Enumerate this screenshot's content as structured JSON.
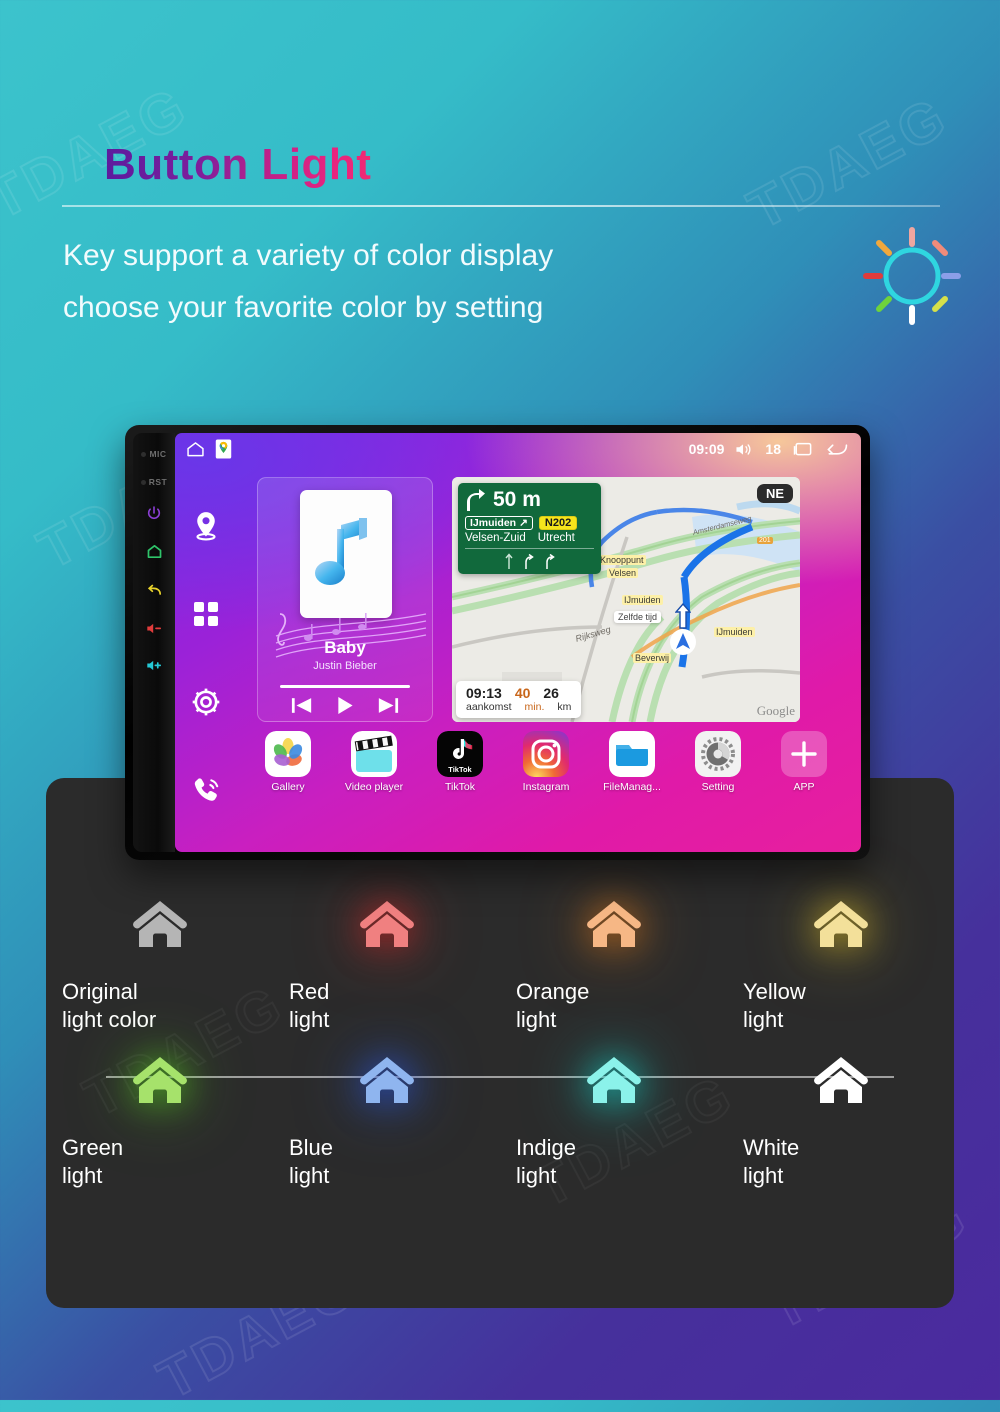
{
  "header": {
    "title": "Button Light",
    "subtitle_line1": "Key support a variety of color display",
    "subtitle_line2": "choose your favorite color by setting",
    "icon": "sun-brightness-icon"
  },
  "watermark": {
    "text": "TDAEG"
  },
  "device": {
    "bezel": {
      "mic_label": "MIC",
      "reset_label": "RST",
      "buttons": [
        {
          "name": "power-button",
          "color": "#8b3fd4"
        },
        {
          "name": "home-button",
          "color": "#2fc46a"
        },
        {
          "name": "back-button",
          "color": "#e8d game"
        },
        {
          "name": "volume-down-button",
          "color": "#e03c3c"
        },
        {
          "name": "volume-up-button",
          "color": "#25c9d6"
        }
      ]
    },
    "statusbar": {
      "home_icon": "home-icon",
      "maps_icon": "google-maps-pin-icon",
      "time": "09:09",
      "volume_icon": "volume-icon",
      "volume_level": "18",
      "recents_icon": "recent-apps-icon",
      "back_icon": "back-arrow-icon"
    },
    "rail": [
      {
        "name": "navigation-icon",
        "label": "navigation"
      },
      {
        "name": "apps-grid-icon",
        "label": "apps"
      },
      {
        "name": "settings-gear-icon",
        "label": "settings"
      },
      {
        "name": "phone-icon",
        "label": "phone"
      }
    ],
    "music": {
      "title": "Baby",
      "artist": "Justin Bieber",
      "album_art": "music-note-icon",
      "prev_icon": "previous-track-icon",
      "play_icon": "play-icon",
      "next_icon": "next-track-icon"
    },
    "map": {
      "distance": "50 m",
      "turn_icon": "turn-right-icon",
      "destination": "IJmuiden",
      "road_number": "N202",
      "exit_left": "Velsen-Zuid",
      "exit_right": "Utrecht",
      "compass": "NE",
      "eta_time": "09:13",
      "eta_time_label": "aankomst",
      "eta_minutes": "40",
      "eta_minutes_label": "min.",
      "eta_distance": "26",
      "eta_distance_label": "km",
      "attribution": "Google",
      "labels": [
        "Knooppunt",
        "Velsen",
        "IJmuiden",
        "IJmuiden",
        "Beverwij",
        "Zelfde tijd",
        "Rijksweg",
        "Amsterdamseweg",
        "201"
      ]
    },
    "dock": [
      {
        "name": "gallery",
        "label": "Gallery"
      },
      {
        "name": "video-player",
        "label": "Video player"
      },
      {
        "name": "tiktok",
        "label": "TikTok"
      },
      {
        "name": "instagram",
        "label": "Instagram"
      },
      {
        "name": "file-manager",
        "label": "FileManag..."
      },
      {
        "name": "setting",
        "label": "Setting"
      },
      {
        "name": "app-add",
        "label": "APP"
      }
    ]
  },
  "colors": [
    {
      "name": "original",
      "label_line1": "Original",
      "label_line2": "light color",
      "hex": "#b5b5b5",
      "glow": "rgba(0,0,0,0)"
    },
    {
      "name": "red",
      "label_line1": "Red",
      "label_line2": "light",
      "hex": "#f08080",
      "glow": "rgba(235,40,40,0.55)"
    },
    {
      "name": "orange",
      "label_line1": "Orange",
      "label_line2": "light",
      "hex": "#f6b785",
      "glow": "rgba(240,130,25,0.55)"
    },
    {
      "name": "yellow",
      "label_line1": "Yellow",
      "label_line2": "light",
      "hex": "#f3e09a",
      "glow": "rgba(240,205,40,0.55)"
    },
    {
      "name": "green",
      "label_line1": "Green",
      "label_line2": "light",
      "hex": "#a6e26b",
      "glow": "rgba(90,220,30,0.60)"
    },
    {
      "name": "blue",
      "label_line1": "Blue",
      "label_line2": "light",
      "hex": "#8fb5ef",
      "glow": "rgba(40,90,235,0.60)"
    },
    {
      "name": "indige",
      "label_line1": "Indige",
      "label_line2": "light",
      "hex": "#8bf2ea",
      "glow": "rgba(20,225,215,0.60)"
    },
    {
      "name": "white",
      "label_line1": "White",
      "label_line2": "light",
      "hex": "#ffffff",
      "glow": "rgba(0,0,0,0)"
    }
  ],
  "theme": {
    "bg_start": "#3cc3cc",
    "bg_end": "#4b2a9e",
    "panel_bg": "#2b2b2b",
    "title_gradient_start": "#5c1b9e",
    "title_gradient_end": "#ef2a74"
  }
}
